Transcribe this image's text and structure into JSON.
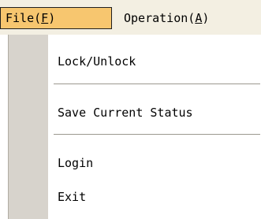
{
  "menubar": {
    "file": {
      "label": "File",
      "mnemonic": "F"
    },
    "operation": {
      "label": "Operation",
      "mnemonic": "A"
    }
  },
  "dropdown": {
    "items": [
      {
        "label": "Lock/Unlock"
      },
      {
        "label": "Save Current Status"
      },
      {
        "label": "Login"
      },
      {
        "label": "Exit"
      }
    ]
  },
  "colors": {
    "menubar_bg": "#f3efe2",
    "active_menu_bg": "#f7c66f",
    "gutter": "#d7d3cc",
    "separator": "#9b988f"
  }
}
